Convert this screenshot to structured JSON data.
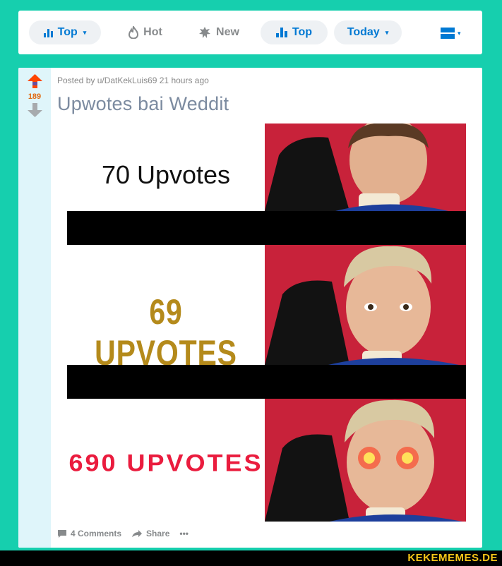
{
  "sortbar": {
    "top_label": "Top",
    "hot_label": "Hot",
    "new_label": "New",
    "top_tab_label": "Top",
    "time_label": "Today",
    "caret": "▾",
    "icons": [
      "bar-chart-icon",
      "flame-icon",
      "sparkle-icon",
      "bar-chart-icon",
      "card-view-icon"
    ]
  },
  "post": {
    "score": "189",
    "meta": "Posted by u/DatKekLuis69 21 hours ago",
    "title": "Upwotes bai Weddit",
    "meme": {
      "panel1_text": "70 Upvotes",
      "panel2_text": "69 UPVOTES",
      "panel3_text": "690 UPVOTES"
    },
    "footer": {
      "comments_label": "4 Comments",
      "share_label": "Share",
      "more_label": "•••"
    }
  },
  "watermark": "KEKEMEMES.DE",
  "colors": {
    "background": "#16cfae",
    "accent": "#0079d3",
    "panel_red": "#c8223a",
    "upvote_orange": "#e06a11"
  }
}
